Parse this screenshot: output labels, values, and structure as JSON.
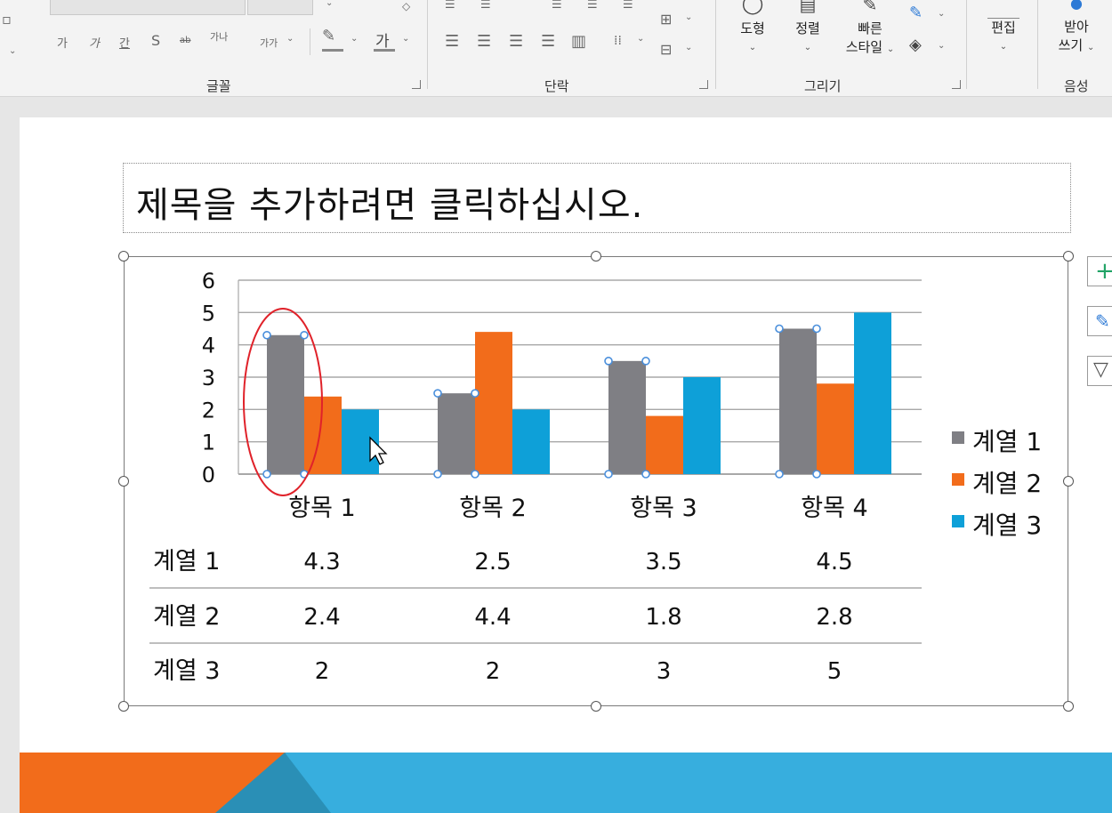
{
  "ribbon": {
    "groups": [
      {
        "id": "font",
        "label": "글꼴"
      },
      {
        "id": "paragraph",
        "label": "단락"
      },
      {
        "id": "drawing",
        "label": "그리기"
      },
      {
        "id": "voice",
        "label": "음성"
      }
    ],
    "font_glyphs": [
      "가",
      "가",
      "간",
      "S",
      "ab",
      "가나",
      "가가",
      "가"
    ],
    "buttons": {
      "shape": "도형",
      "arrange": "정렬",
      "quick_style_1": "빠른",
      "quick_style_2": "스타일",
      "edit": "편집",
      "dictate_1": "받아",
      "dictate_2": "쓰기"
    }
  },
  "slide": {
    "title_placeholder": "제목을 추가하려면 클릭하십시오."
  },
  "colors": {
    "series1": "#7f7f84",
    "series2": "#f26c1b",
    "series3": "#0ea0d8",
    "accent_orange": "#f26c1b",
    "accent_blue": "#37aede",
    "annotation_red": "#e0222a",
    "selection_handle": "#4a8fdc"
  },
  "chart_data": {
    "type": "bar",
    "categories": [
      "항목 1",
      "항목 2",
      "항목 3",
      "항목 4"
    ],
    "series": [
      {
        "name": "계열 1",
        "values": [
          4.3,
          2.5,
          3.5,
          4.5
        ]
      },
      {
        "name": "계열 2",
        "values": [
          2.4,
          4.4,
          1.8,
          2.8
        ]
      },
      {
        "name": "계열 3",
        "values": [
          2,
          2,
          3,
          5
        ]
      }
    ],
    "ylim": [
      0,
      6
    ],
    "yticks": [
      "0",
      "1",
      "2",
      "3",
      "4",
      "5",
      "6"
    ],
    "grid": true,
    "legend": "right",
    "data_table": [
      {
        "series": "계열 1",
        "values": [
          "4.3",
          "2.5",
          "3.5",
          "4.5"
        ]
      },
      {
        "series": "계열 2",
        "values": [
          "2.4",
          "4.4",
          "1.8",
          "2.8"
        ]
      },
      {
        "series": "계열 3",
        "values": [
          "2",
          "2",
          "3",
          "5"
        ]
      }
    ],
    "selected_series": "계열 1",
    "annotation": "red ellipse around 항목 1 계열 1 bar"
  }
}
